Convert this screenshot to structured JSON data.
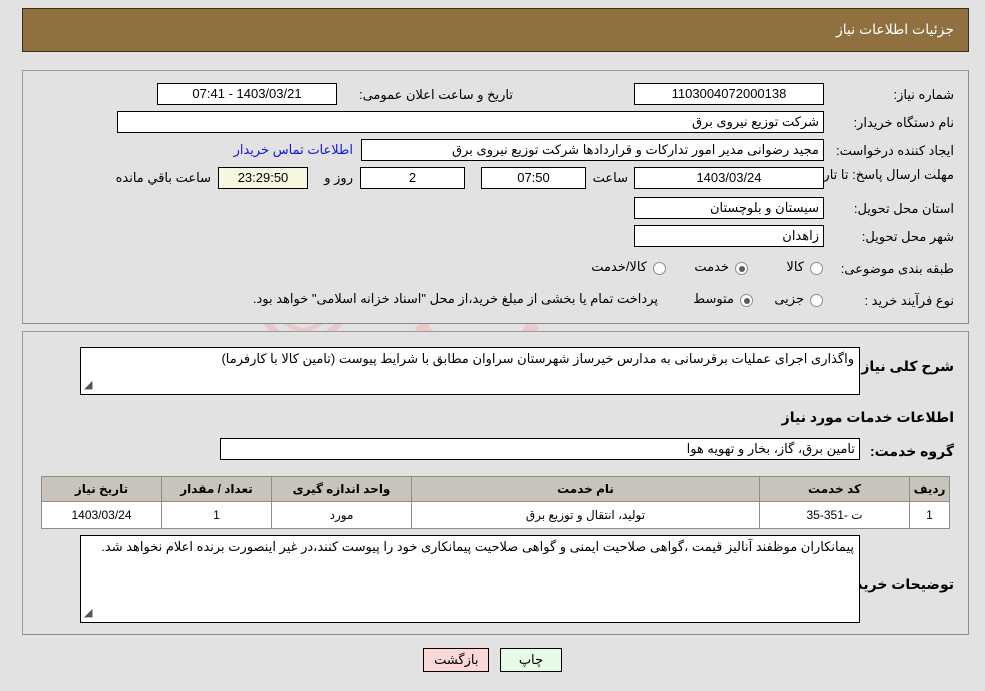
{
  "header": {
    "title": "جزئیات اطلاعات نیاز"
  },
  "watermark": {
    "text": "AriaTender.net"
  },
  "top_panel": {
    "need_number": {
      "label": "شماره نیاز:",
      "value": "1103004072000138"
    },
    "announce_datetime": {
      "label": "تاریخ و ساعت اعلان عمومی:",
      "value": "1403/03/21 - 07:41"
    },
    "buyer_org": {
      "label": "نام دستگاه خریدار:",
      "value": "شرکت توزیع نیروی برق"
    },
    "request_creator": {
      "label": "ایجاد کننده درخواست:",
      "value": "مجید  رضوانی مدیر امور تدارکات و قراردادها شرکت توزیع نیروی برق"
    },
    "buyer_contact_link": "اطلاعات تماس خریدار",
    "deadline": {
      "label": "مهلت ارسال پاسخ: تا تاریخ:",
      "date": "1403/03/24",
      "time_label": "ساعت",
      "time": "07:50",
      "days": "2",
      "days_label": "روز و",
      "countdown": "23:29:50",
      "remaining_label": "ساعت باقي مانده"
    },
    "delivery_province": {
      "label": "استان محل تحویل:",
      "value": "سیستان و بلوچستان"
    },
    "delivery_city": {
      "label": "شهر محل تحویل:",
      "value": "زاهدان"
    },
    "subject_category": {
      "label": "طبقه بندی موضوعی:",
      "options": [
        "کالا",
        "خدمت",
        "کالا/خدمت"
      ],
      "selected": "خدمت"
    },
    "purchase_process": {
      "label": "نوع فرآیند خرید :",
      "options": [
        "جزیی",
        "متوسط"
      ],
      "selected": "متوسط"
    },
    "treasury_note": "پرداخت تمام یا بخشی از مبلغ خرید،از محل \"اسناد خزانه اسلامی\" خواهد بود."
  },
  "bottom_panel": {
    "need_summary": {
      "label": "شرح کلی نیاز:",
      "value": "واگذاری اجرای عملیات برقرسانی به مدارس خیرساز شهرستان سراوان مطابق با شرایط پیوست (تامین کالا با کارفرما)"
    },
    "services_section_title": "اطلاعات خدمات مورد نیاز",
    "service_group": {
      "label": "گروه خدمت:",
      "value": "تامین برق، گاز، بخار و تهویه هوا"
    },
    "table": {
      "columns": [
        "ردیف",
        "کد خدمت",
        "نام خدمت",
        "واحد اندازه گیری",
        "تعداد / مقدار",
        "تاریخ نیاز"
      ],
      "rows": [
        {
          "row": "1",
          "service_code": "ت -351-35",
          "service_name": "تولید، انتقال و توزیع برق",
          "unit": "مورد",
          "quantity": "1",
          "need_date": "1403/03/24"
        }
      ]
    },
    "buyer_notes": {
      "label": "توضیحات خریدار:",
      "value": "پیمانکاران موظفند آنالیز قیمت ،گواهی صلاحیت ایمنی و گواهی صلاحیت پیمانکاری خود را پیوست کنند،در غیر اینصورت برنده اعلام نخواهد شد."
    }
  },
  "footer": {
    "print_button": "چاپ",
    "back_button": "بازگشت"
  },
  "colors": {
    "header_bg": "#90703f",
    "page_bg": "#e2e2e2",
    "link": "#1616d8",
    "countdown_bg": "#f7f6e0",
    "table_header_bg": "#c8c4bc",
    "btn_back_bg": "#fbd7d7",
    "btn_print_bg": "#e6fbe6"
  }
}
